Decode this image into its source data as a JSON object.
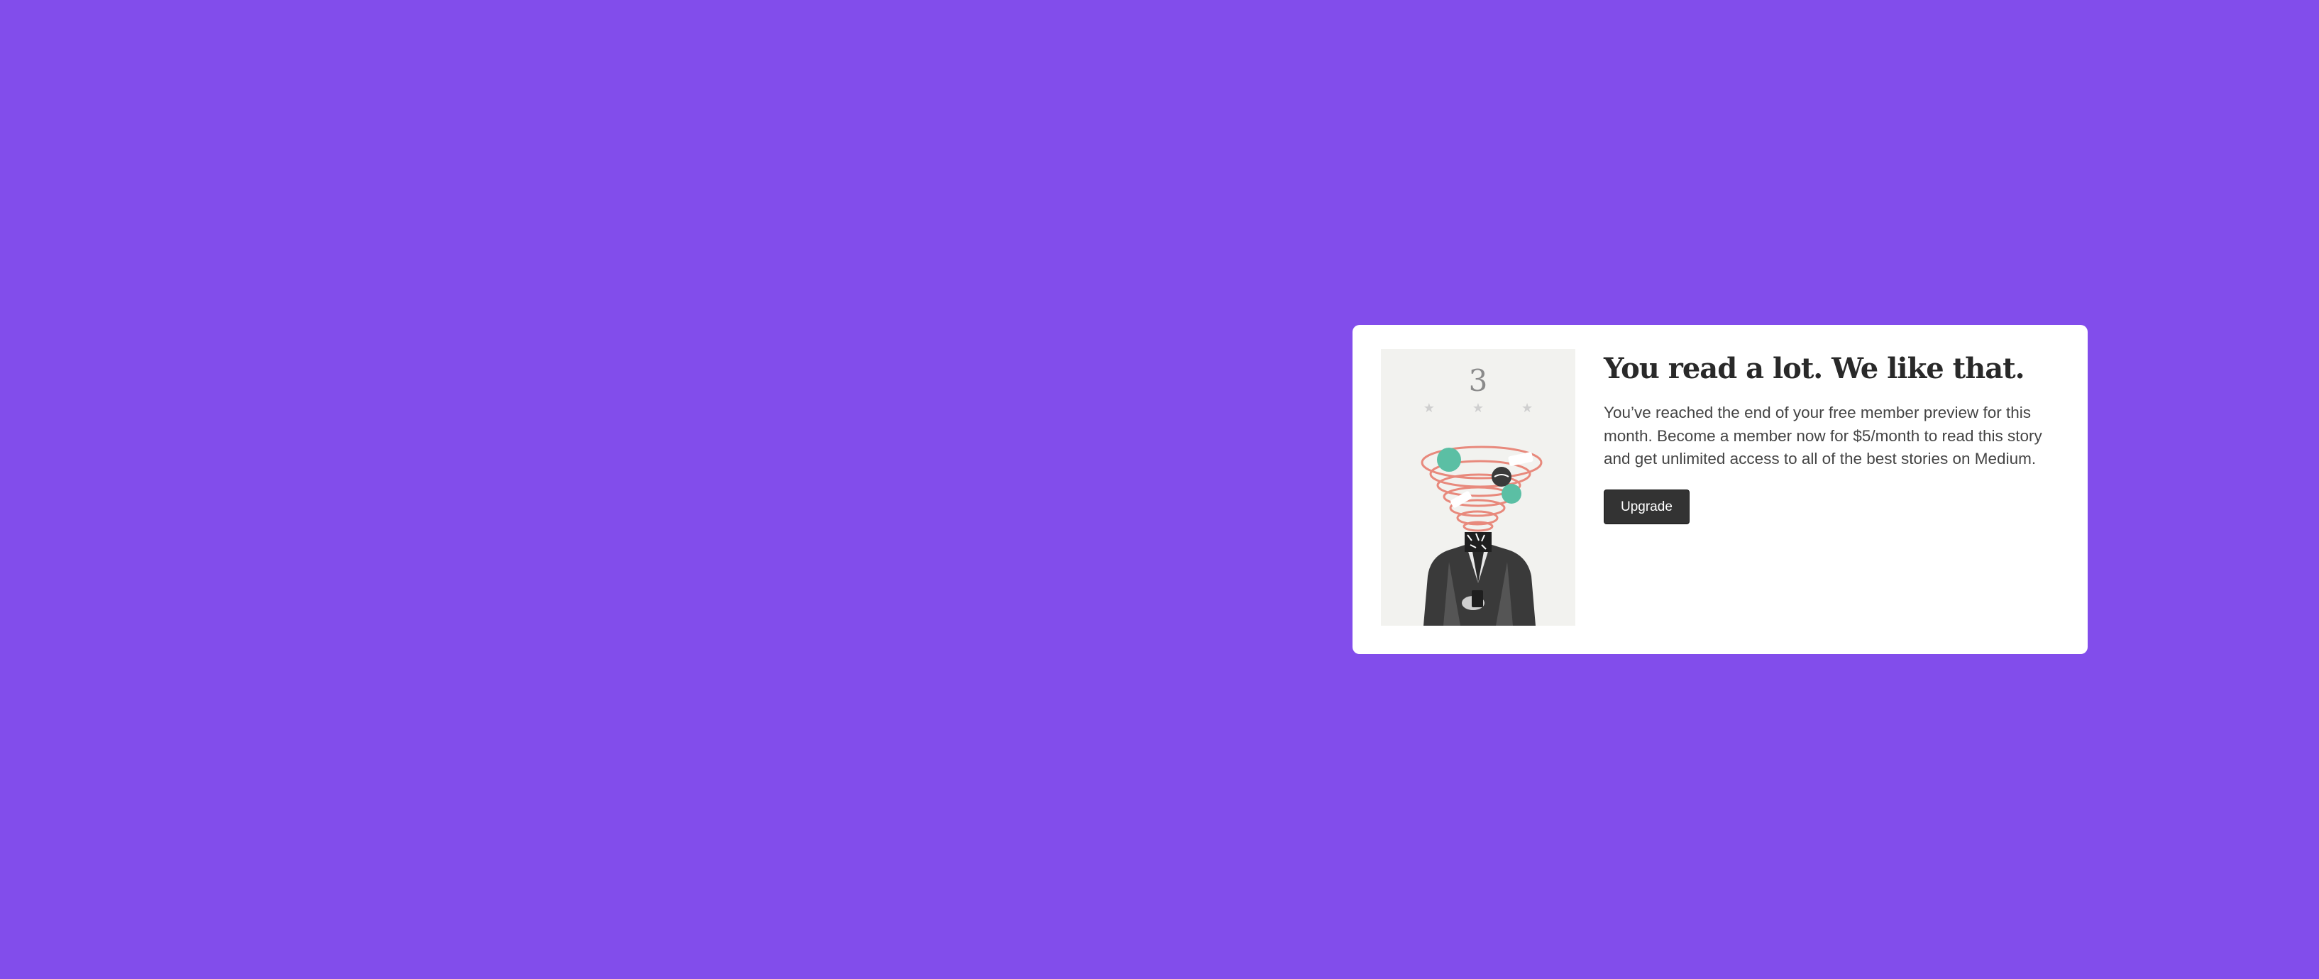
{
  "page": {
    "background_color": "#824deb"
  },
  "paywall": {
    "illustration": {
      "count": "3",
      "stars": "★ ★ ★"
    },
    "headline": "You read a lot. We like that.",
    "body": "You’ve reached the end of your free member preview for this month. Become a member now for $5/month to read this story and get unlimited access to all of the best stories on Medium.",
    "upgrade_label": "Upgrade"
  },
  "colors": {
    "card_background": "#ffffff",
    "button_background": "#333333",
    "headline": "#292929",
    "accent_teal": "#5bbfa4",
    "accent_coral": "#e8897c"
  }
}
